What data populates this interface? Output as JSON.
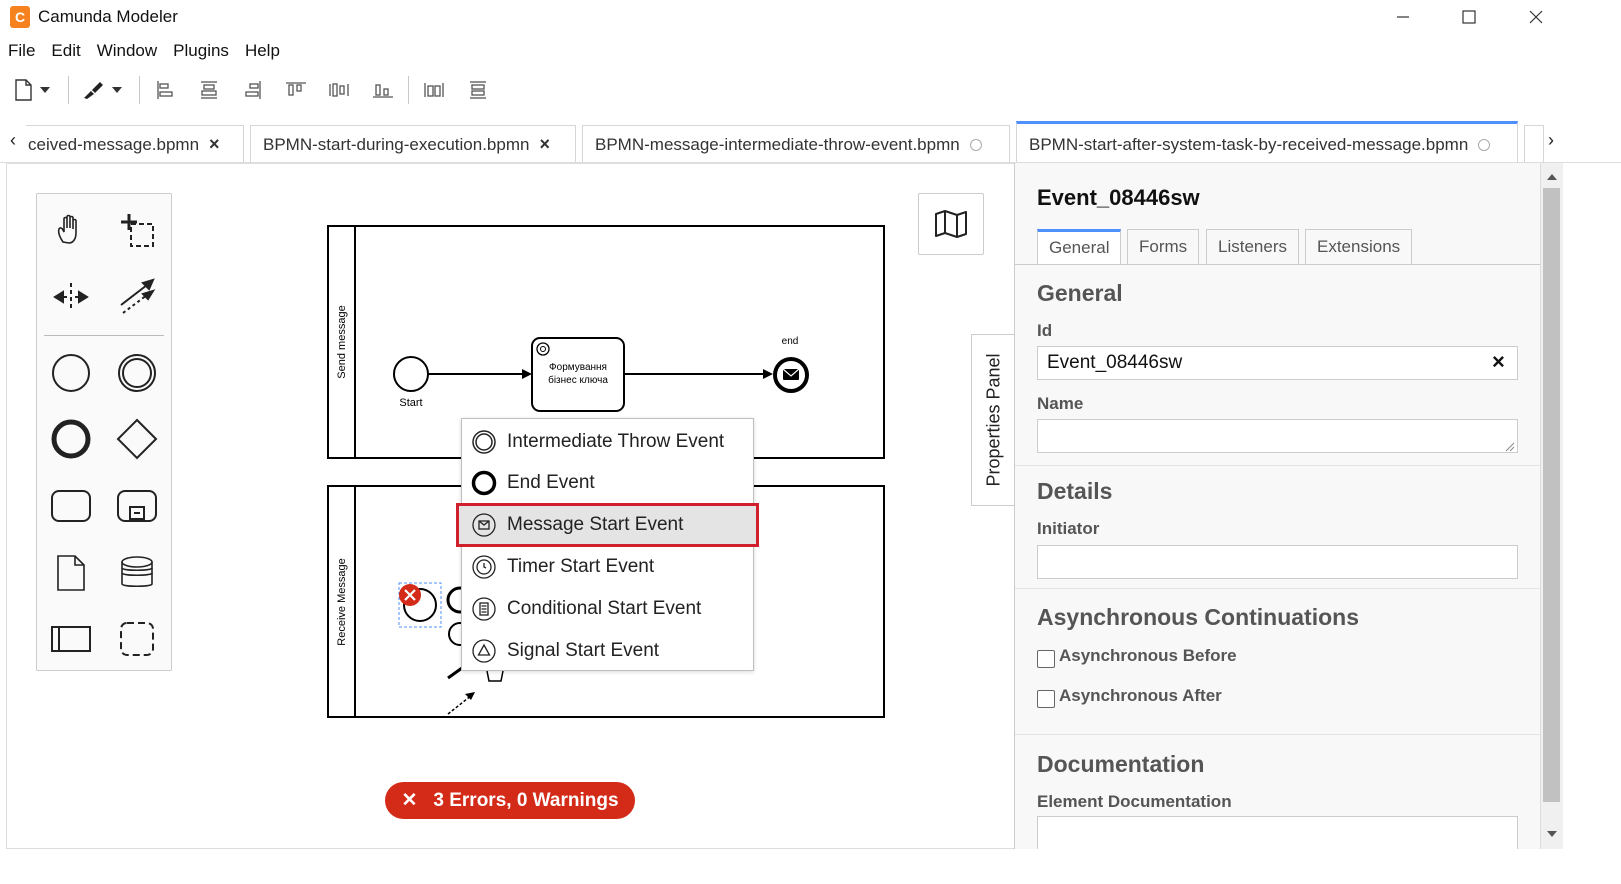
{
  "window": {
    "title": "Camunda Modeler",
    "logo_glyph": "C"
  },
  "menu": [
    "File",
    "Edit",
    "Window",
    "Plugins",
    "Help"
  ],
  "tabs": {
    "scroll_left": "‹",
    "scroll_right": "›",
    "items": [
      {
        "label": "ceived-message.bpmn",
        "state": "close"
      },
      {
        "label": "BPMN-start-during-execution.bpmn",
        "state": "close"
      },
      {
        "label": "BPMN-message-intermediate-throw-event.bpmn",
        "state": "unsaved"
      },
      {
        "label": "BPMN-start-after-system-task-by-received-message.bpmn",
        "state": "unsaved",
        "active": true
      }
    ],
    "close_glyph": "×"
  },
  "diagram": {
    "lane_top_label": "Send message",
    "lane_bottom_label": "Receive Message",
    "start_label": "Start",
    "task_label_line1": "Формування",
    "task_label_line2": "бізнес ключа",
    "end_label": "end"
  },
  "context_menu": {
    "items": [
      {
        "label": "Intermediate Throw Event",
        "icon": "intermediate-event-icon"
      },
      {
        "label": "End Event",
        "icon": "end-event-icon"
      },
      {
        "label": "Message Start Event",
        "icon": "message-start-icon",
        "highlighted": true
      },
      {
        "label": "Timer Start Event",
        "icon": "timer-start-icon"
      },
      {
        "label": "Conditional Start Event",
        "icon": "conditional-start-icon"
      },
      {
        "label": "Signal Start Event",
        "icon": "signal-start-icon"
      }
    ]
  },
  "errors_badge": {
    "icon": "✕",
    "text": "3 Errors, 0 Warnings"
  },
  "properties_toggle": "Properties Panel",
  "properties": {
    "title": "Event_08446sw",
    "tabs": [
      "General",
      "Forms",
      "Listeners",
      "Extensions"
    ],
    "section_general": "General",
    "id_label": "Id",
    "id_value": "Event_08446sw",
    "clear_glyph": "×",
    "name_label": "Name",
    "name_value": "",
    "section_details": "Details",
    "initiator_label": "Initiator",
    "initiator_value": "",
    "section_async": "Asynchronous Continuations",
    "async_before": "Asynchronous Before",
    "async_after": "Asynchronous After",
    "section_docs": "Documentation",
    "docs_label": "Element Documentation"
  },
  "colors": {
    "accent": "#4d90fe",
    "error": "#d42a18",
    "highlight_border": "#d0202e",
    "logo": "#f5821f"
  }
}
